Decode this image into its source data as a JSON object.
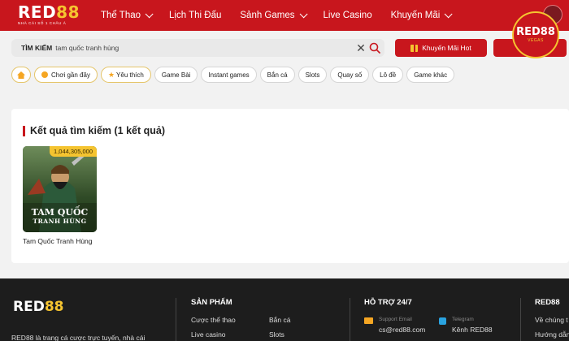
{
  "header": {
    "logo": {
      "brand": "RED",
      "brand_num": "88",
      "tagline": "NHÀ CÁI SỐ 1 CHÂU Á"
    },
    "nav": [
      {
        "label": "Thể Thao",
        "has_dropdown": true
      },
      {
        "label": "Lịch Thi Đấu",
        "has_dropdown": false
      },
      {
        "label": "Sảnh Games",
        "has_dropdown": true
      },
      {
        "label": "Live Casino",
        "has_dropdown": false
      },
      {
        "label": "Khuyến Mãi",
        "has_dropdown": true
      }
    ]
  },
  "badge": {
    "text": "RED88",
    "sub": "VEGAS"
  },
  "search": {
    "label": "TÌM KIẾM",
    "value": "tam quốc tranh hùng",
    "clear_icon": "close-icon",
    "search_icon": "search-icon"
  },
  "promo_buttons": [
    {
      "label": "Khuyến Mãi Hot",
      "icon": "gift-icon"
    },
    {
      "label": "",
      "icon": "gift-icon"
    }
  ],
  "filters": [
    {
      "label": "",
      "icon": "home-icon"
    },
    {
      "label": "Chơi gần đây",
      "icon": "clock-icon"
    },
    {
      "label": "Yêu thích",
      "icon": "star-icon"
    },
    {
      "label": "Game Bài"
    },
    {
      "label": "Instant games"
    },
    {
      "label": "Bắn cá"
    },
    {
      "label": "Slots"
    },
    {
      "label": "Quay số"
    },
    {
      "label": "Lô đề"
    },
    {
      "label": "Game khác"
    }
  ],
  "results": {
    "title": "Kết quả tìm kiếm (1 kết quả)",
    "games": [
      {
        "name": "Tam Quốc Tranh Hùng",
        "jackpot": "1,044,305,000",
        "art_line1": "TAM QUỐC",
        "art_line2": "TRANH HÙNG"
      }
    ]
  },
  "footer": {
    "logo": {
      "brand": "RED",
      "brand_num": "88"
    },
    "description": "RED88 là trang cá cược trực tuyến, nhà cái",
    "products": {
      "title": "SẢN PHẨM",
      "links": [
        "Cược thể thao",
        "Bắn cá",
        "Live casino",
        "Slots"
      ]
    },
    "support": {
      "title": "HỖ TRỢ 24/7",
      "email_label": "Support Email",
      "email": "cs@red88.com",
      "telegram_label": "Telegram",
      "telegram": "Kênh RED88"
    },
    "about": {
      "title": "RED88",
      "links": [
        "Về chúng t",
        "Hướng dẫn"
      ]
    }
  },
  "colors": {
    "brand_red": "#c8161d",
    "gold": "#f5c430",
    "footer_bg": "#1d1d1d"
  }
}
